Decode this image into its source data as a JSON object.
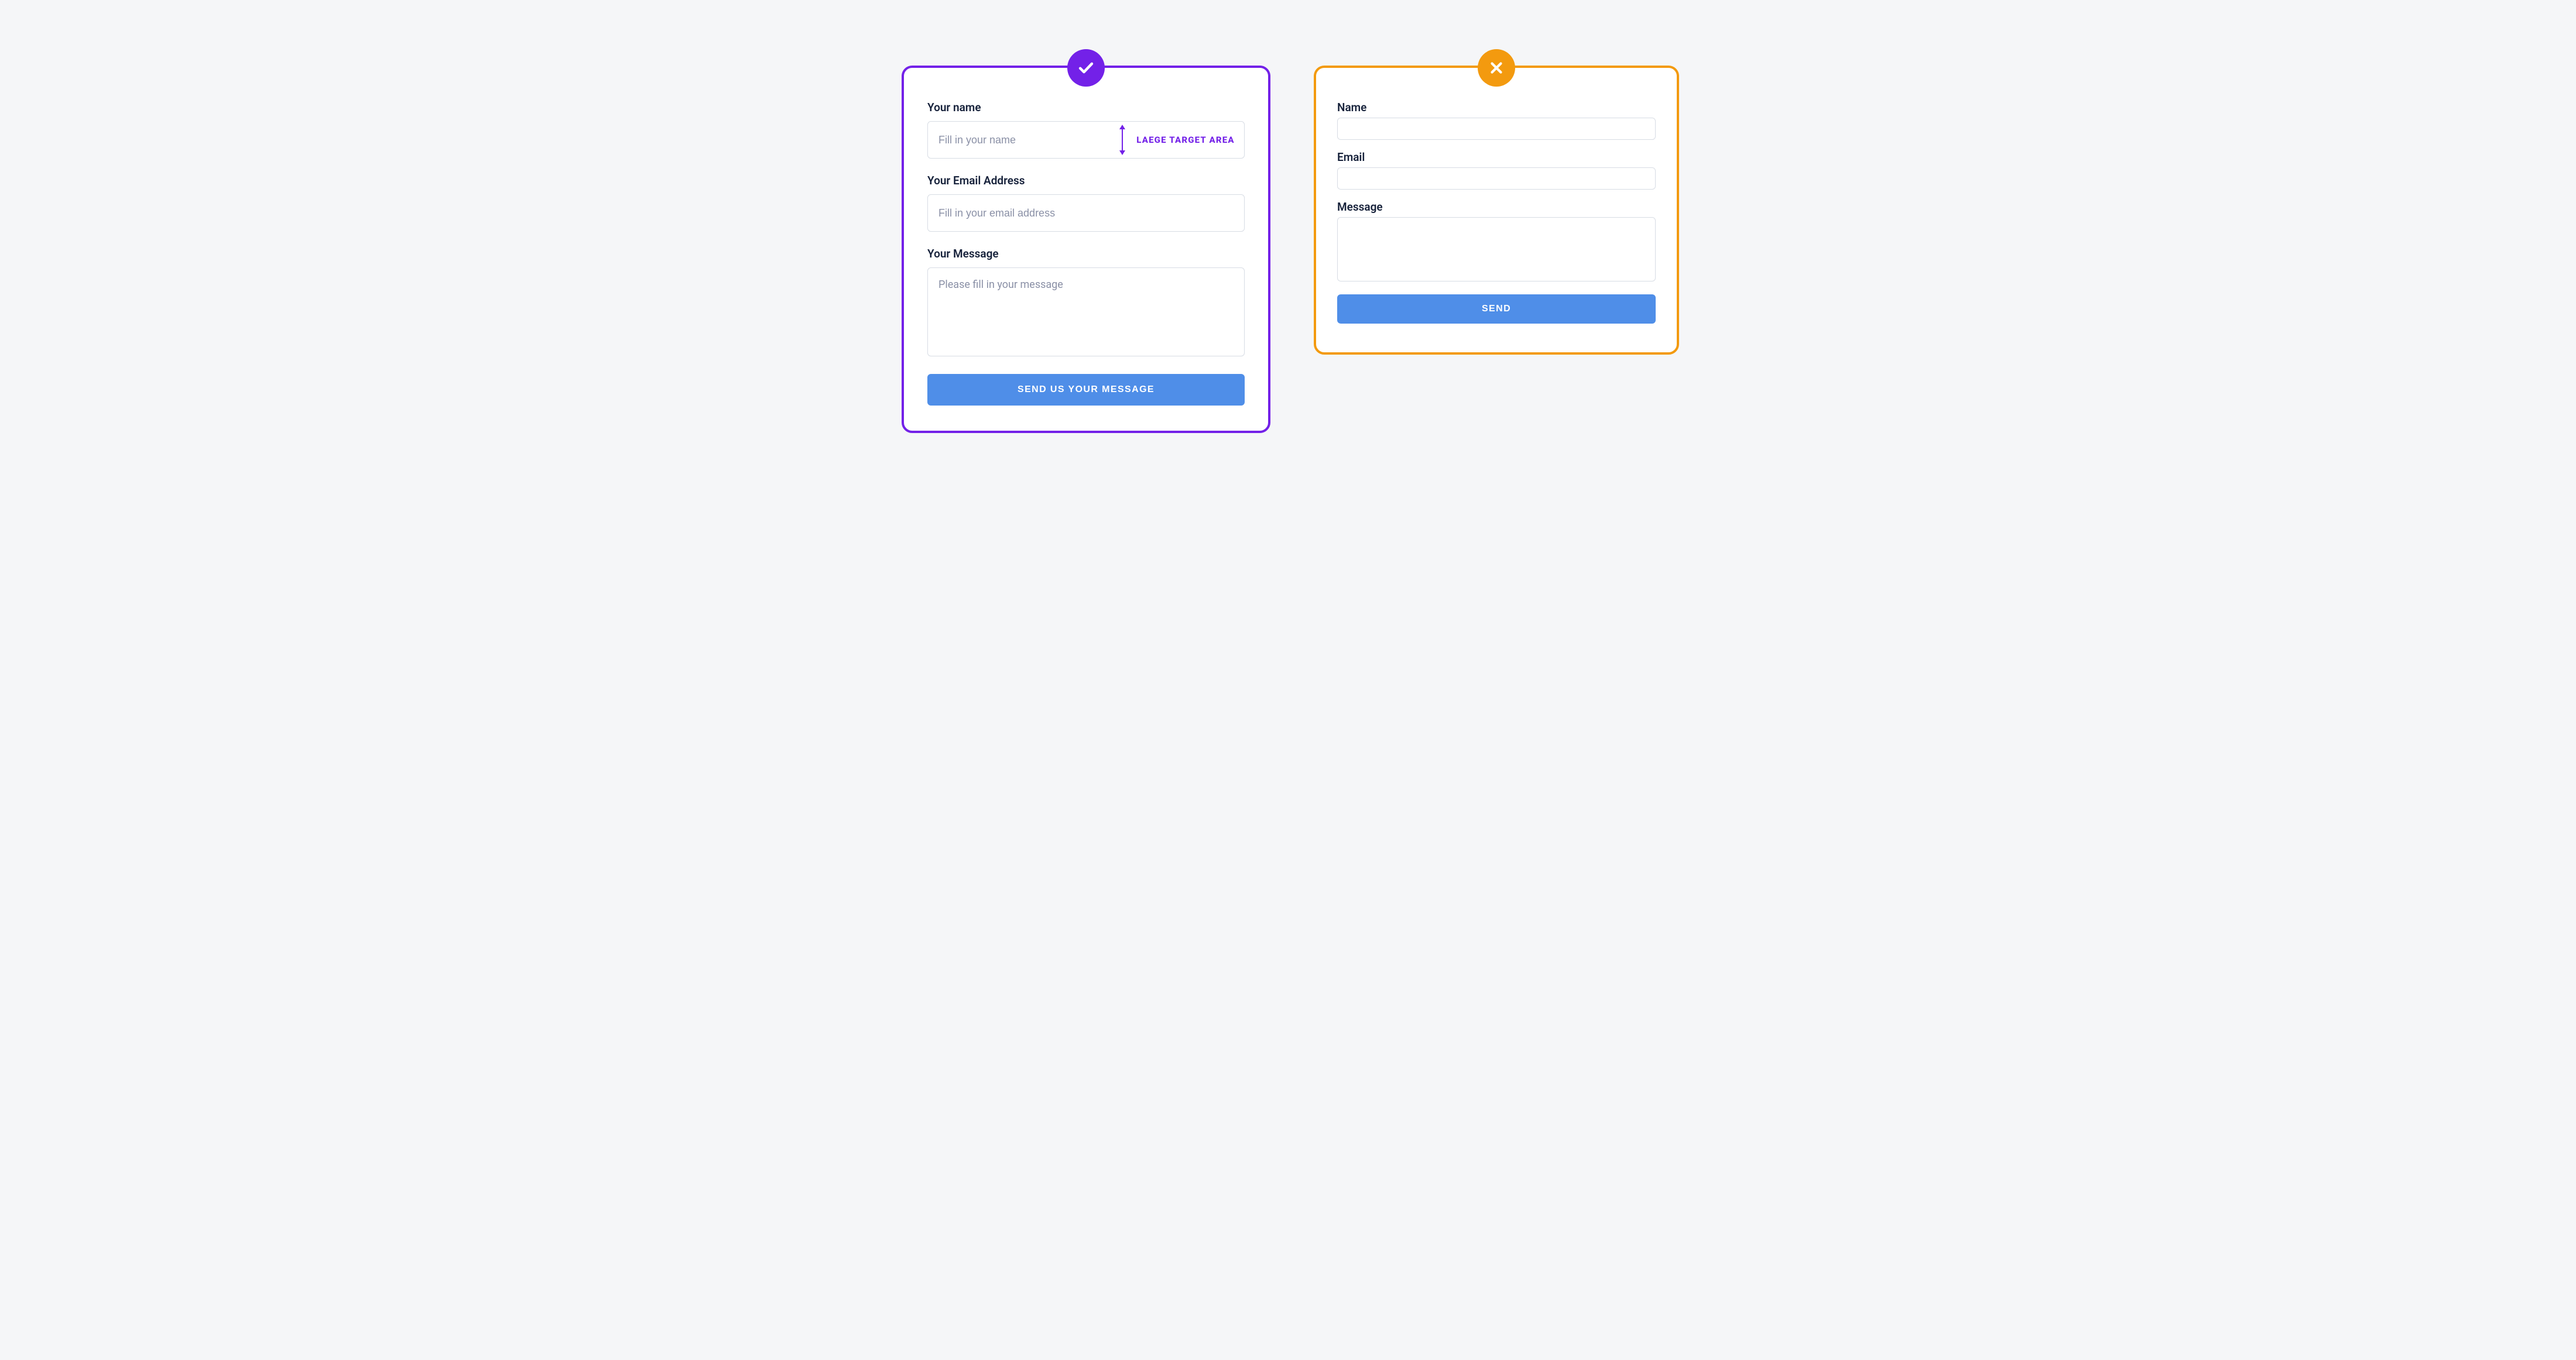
{
  "good": {
    "name_label": "Your name",
    "name_placeholder": "Fill in your name",
    "name_annotation": "LAEGE TARGET AREA",
    "email_label": "Your Email Address",
    "email_placeholder": "Fill in your email address",
    "message_label": "Your Message",
    "message_placeholder": "Please fill in your message",
    "submit_label": "SEND US YOUR MESSAGE"
  },
  "bad": {
    "name_label": "Name",
    "email_label": "Email",
    "message_label": "Message",
    "submit_label": "SEND"
  },
  "colors": {
    "good_border": "#7321E8",
    "bad_border": "#F39A0F",
    "button": "#4f8ee8"
  }
}
